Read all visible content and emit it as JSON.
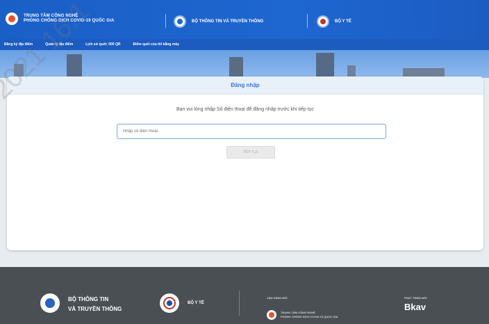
{
  "header": {
    "brand_line1": "TRUNG TÂM CÔNG NGHỆ",
    "brand_line2": "PHÒNG CHỐNG DỊCH COVID-19 QUỐC GIA",
    "ministry_info": "BỘ THÔNG TIN VÀ TRUYỀN THÔNG",
    "ministry_health": "BỘ Y TẾ"
  },
  "nav": {
    "items": [
      "Đăng ký địa điểm",
      "Quản lý địa điểm",
      "Lịch sử quét: 000 QR",
      "Điểm quét của tôi bằng máy"
    ]
  },
  "card": {
    "title": "Đăng nhập",
    "instruction": "Bạn vui lòng nhập Số điện thoại để đăng nhập trước khi tiếp tục",
    "phone_placeholder": "Nhập số điện thoại",
    "continue_label": "TIẾP TỤC"
  },
  "footer": {
    "ministry_info_line1": "BỘ THÔNG TIN",
    "ministry_info_line2": "VÀ TRUYỀN THÔNG",
    "ministry_health": "BỘ Y TẾ",
    "operated_by": "VẬN HÀNH BỞI",
    "org_line1": "TRUNG TÂM CÔNG NGHỆ",
    "org_line2": "PHÒNG CHỐNG DỊCH COVID-19 QUỐC GIA",
    "developed_by": "PHÁT TRIỂN BỞI",
    "developer": "Bkav"
  },
  "watermark": "2021 16:1",
  "colors": {
    "header_blue": "#1e66d0",
    "title_blue": "#3776d0",
    "footer_gray": "#4a4f54"
  }
}
